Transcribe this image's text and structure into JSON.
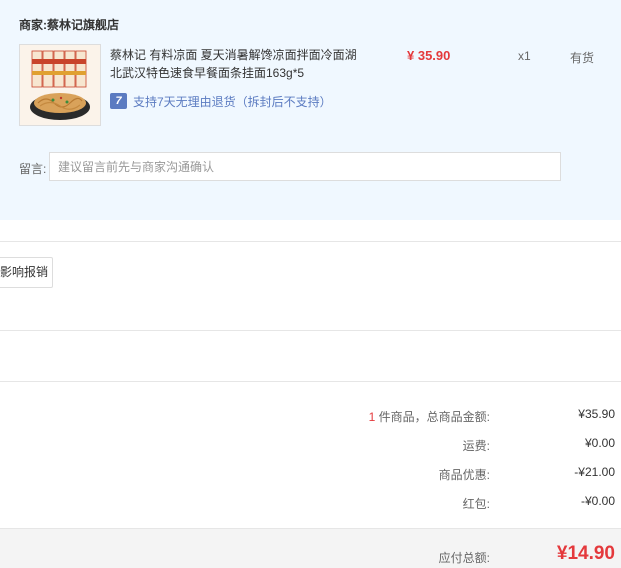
{
  "shop": {
    "label": "商家:",
    "name": "蔡林记旗舰店"
  },
  "product": {
    "title": "蔡林记 有料凉面 夏天消暑解馋凉面拌面冷面湖北武汉特色速食早餐面条挂面163g*5",
    "price": "¥ 35.90",
    "quantity": "x1",
    "stock": "有货",
    "return_policy": "支持7天无理由退货（拆封后不支持）",
    "return_icon": "seven-day-return-icon",
    "image_pack_text": "蔡林记凉面"
  },
  "remark": {
    "label": "留言:",
    "placeholder": "建议留言前先与商家沟通确认"
  },
  "report_button": {
    "label": "影响报销"
  },
  "summary": {
    "count": "1",
    "count_suffix": " 件商品，总商品金额:",
    "goods_amount": "¥35.90",
    "shipping_label": "运费:",
    "shipping": "¥0.00",
    "discount_label": "商品优惠:",
    "discount": "-¥21.00",
    "red_packet_label": "红包:",
    "red_packet": "-¥0.00",
    "total_label": "应付总额:",
    "total": "¥14.90"
  },
  "colors": {
    "accent_red": "#e4393c",
    "link_blue": "#5b7bc1",
    "panel_bg": "#f0f8ff"
  }
}
